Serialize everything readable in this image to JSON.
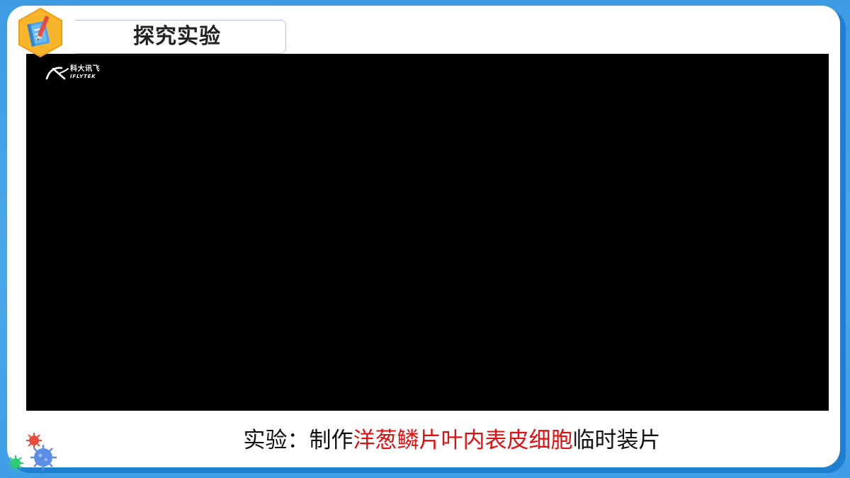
{
  "slide": {
    "title": "探究实验"
  },
  "video": {
    "watermark_cn": "科大讯飞",
    "watermark_en": "IFLYTEK"
  },
  "caption": {
    "prefix": "实验：制作",
    "highlight": "洋葱鳞片叶内表皮细胞",
    "suffix": "临时装片"
  },
  "colors": {
    "background": "#3d9be3",
    "highlight": "#e01010",
    "badge": "#f7b52c",
    "video_bg": "#000000"
  },
  "icons": {
    "badge": "notebook-pen-icon",
    "decoration": "virus-icon"
  }
}
